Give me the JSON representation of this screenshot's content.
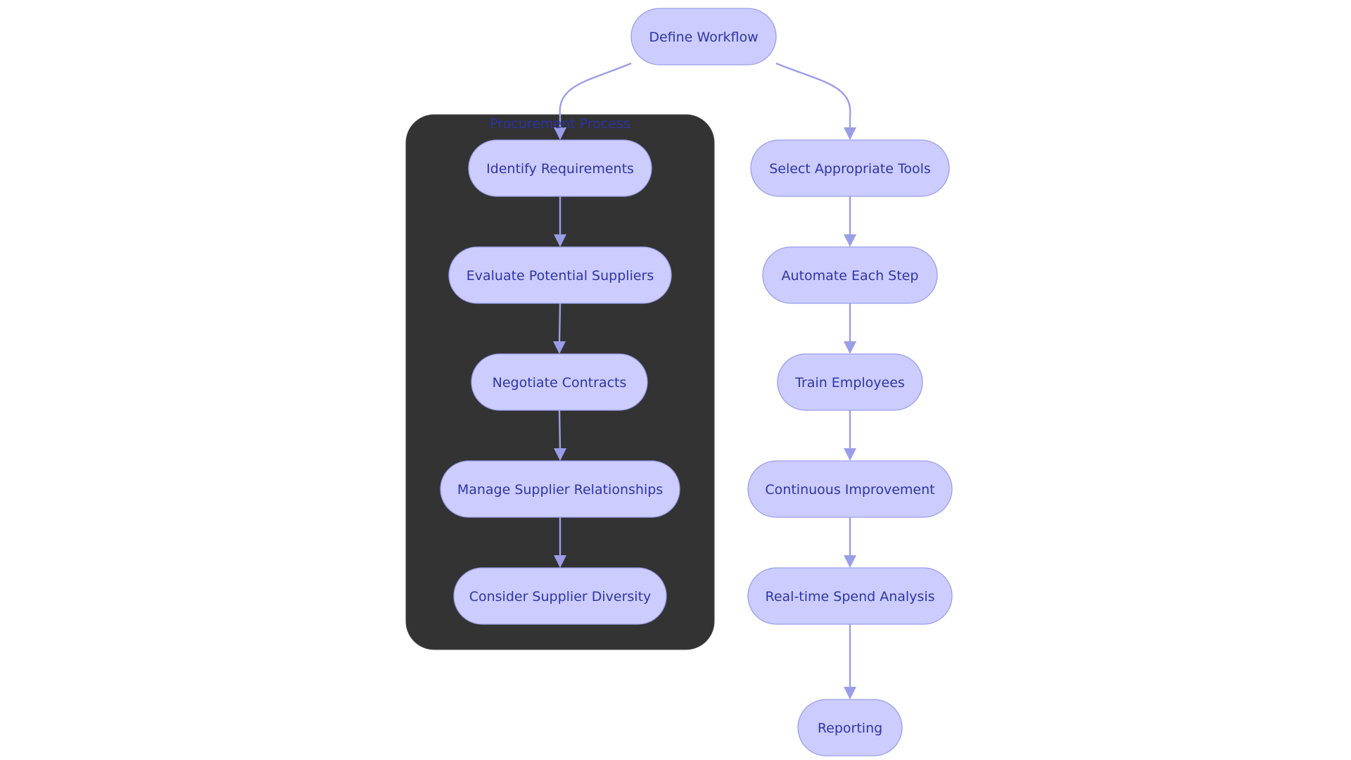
{
  "diagram": {
    "type": "flowchart",
    "colors": {
      "node_fill": "#ccccff",
      "node_stroke": "#9a9ee8",
      "node_text": "#2e35a6",
      "edge": "#9a9ee8",
      "cluster_fill": "#333333",
      "cluster_text": "#2a34b8"
    },
    "cluster": {
      "id": "procurement",
      "label": "Procurement Process"
    },
    "nodes": [
      {
        "id": "define",
        "label": "Define Workflow"
      },
      {
        "id": "identify",
        "label": "Identify Requirements",
        "cluster": "procurement"
      },
      {
        "id": "evaluate",
        "label": "Evaluate Potential Suppliers",
        "cluster": "procurement"
      },
      {
        "id": "negotiate",
        "label": "Negotiate Contracts",
        "cluster": "procurement"
      },
      {
        "id": "manage",
        "label": "Manage Supplier Relationships",
        "cluster": "procurement"
      },
      {
        "id": "diversity",
        "label": "Consider Supplier Diversity",
        "cluster": "procurement"
      },
      {
        "id": "select",
        "label": "Select Appropriate Tools"
      },
      {
        "id": "automate",
        "label": "Automate Each Step"
      },
      {
        "id": "train",
        "label": "Train Employees"
      },
      {
        "id": "improve",
        "label": "Continuous Improvement"
      },
      {
        "id": "spend",
        "label": "Real-time Spend Analysis"
      },
      {
        "id": "reporting",
        "label": "Reporting"
      }
    ],
    "edges": [
      {
        "from": "define",
        "to": "identify"
      },
      {
        "from": "define",
        "to": "select"
      },
      {
        "from": "identify",
        "to": "evaluate"
      },
      {
        "from": "evaluate",
        "to": "negotiate"
      },
      {
        "from": "negotiate",
        "to": "manage"
      },
      {
        "from": "manage",
        "to": "diversity"
      },
      {
        "from": "select",
        "to": "automate"
      },
      {
        "from": "automate",
        "to": "train"
      },
      {
        "from": "train",
        "to": "improve"
      },
      {
        "from": "improve",
        "to": "spend"
      },
      {
        "from": "spend",
        "to": "reporting"
      }
    ]
  }
}
